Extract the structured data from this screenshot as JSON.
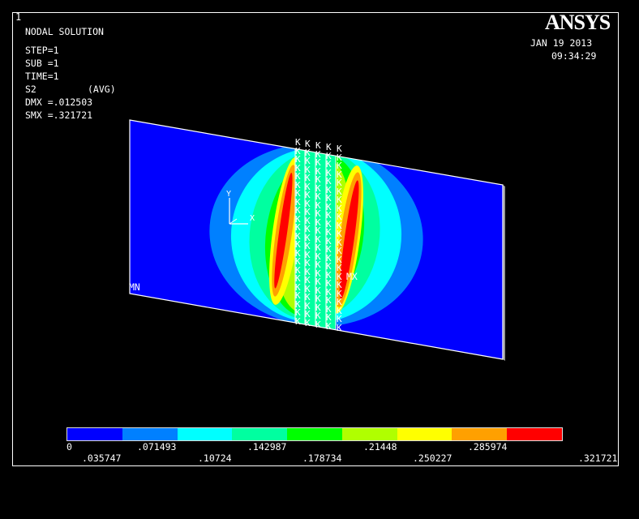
{
  "window_number": "1",
  "logo": "ANSYS",
  "header": {
    "title": "NODAL SOLUTION",
    "step": "STEP=1",
    "sub": "SUB =1",
    "time": "TIME=1",
    "quantity": "S2",
    "averaging": "(AVG)",
    "dmx": "DMX =.012503",
    "smx": "SMX =.321721"
  },
  "timestamp": {
    "date": "JAN 19 2013",
    "time": "09:34:29"
  },
  "model_labels": {
    "min_marker": "MN",
    "max_marker": "MX",
    "axis_y": "Y",
    "axis_x": "X",
    "boundary_symbol": "K"
  },
  "legend": {
    "colors": [
      "#0000ff",
      "#0080ff",
      "#00ffff",
      "#00ffa0",
      "#00ff00",
      "#b0ff00",
      "#ffff00",
      "#ffa000",
      "#ff0000"
    ],
    "top_labels": [
      "0",
      ".071493",
      ".142987",
      ".21448",
      ".285974"
    ],
    "bottom_labels": [
      ".035747",
      ".10724",
      ".178734",
      ".250227",
      ".321721"
    ]
  }
}
